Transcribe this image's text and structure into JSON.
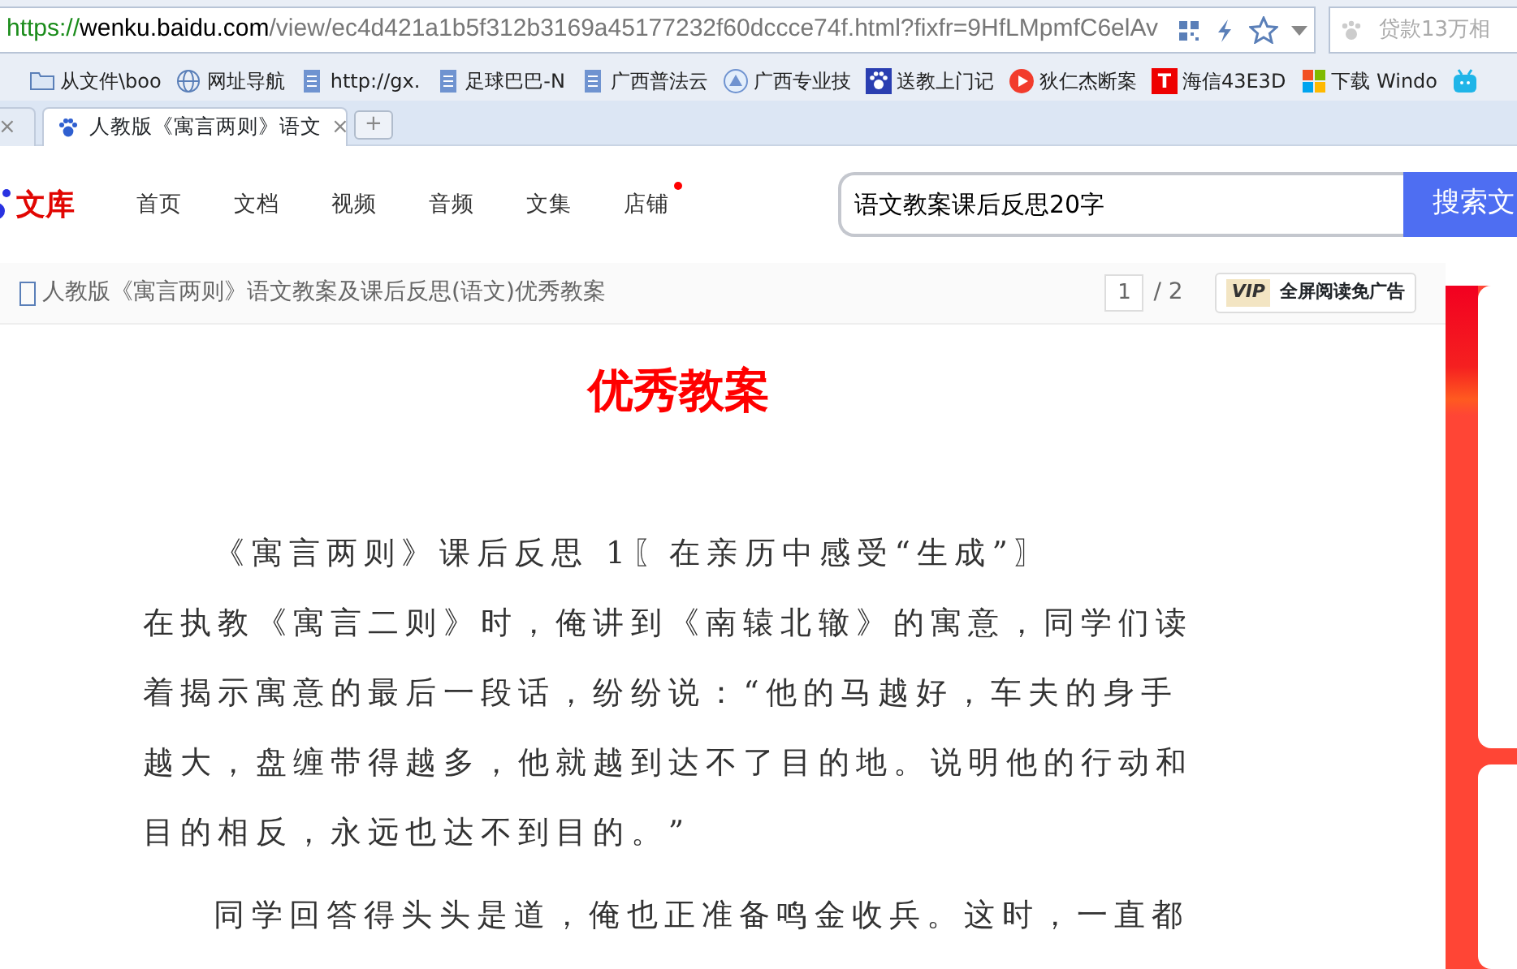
{
  "address_bar": {
    "scheme": "https://",
    "host": "wenku.baidu.com",
    "path": "/view/ec4d421a1b5f312b3169a45177232f60dccce74f.html?fixfr=9HfLMpmfC6elAv",
    "search_placeholder": "贷款13万相"
  },
  "bookmarks": [
    {
      "label": "从文件\\boo",
      "kind": "folder"
    },
    {
      "label": "网址导航",
      "kind": "globe"
    },
    {
      "label": "http://gx.",
      "kind": "page"
    },
    {
      "label": "足球巴巴-N",
      "kind": "page"
    },
    {
      "label": "广西普法云",
      "kind": "page"
    },
    {
      "label": "广西专业技",
      "kind": "cloud"
    },
    {
      "label": "送教上门记",
      "kind": "paw"
    },
    {
      "label": "狄仁杰断案",
      "kind": "play"
    },
    {
      "label": "海信43E3D",
      "kind": "letter",
      "mark": "T"
    },
    {
      "label": "下载 Windo",
      "kind": "windows"
    },
    {
      "kind": "tv"
    }
  ],
  "tabs": [
    {
      "close": "×",
      "selected": false
    },
    {
      "title": "人教版《寓言两则》语文",
      "close": "×",
      "selected": true
    }
  ],
  "new_tab": "+",
  "site": {
    "logo": "文库",
    "nav": [
      {
        "label": "首页",
        "dot": false
      },
      {
        "label": "文档",
        "dot": false
      },
      {
        "label": "视频",
        "dot": false
      },
      {
        "label": "音频",
        "dot": false
      },
      {
        "label": "文集",
        "dot": false
      },
      {
        "label": "店铺",
        "dot": true
      }
    ],
    "search_value": "语文教案课后反思20字",
    "search_button": "搜索文"
  },
  "doc_bar": {
    "title": "人教版《寓言两则》语文教案及课后反思(语文)优秀教案",
    "page": "1",
    "pages": "/ 2",
    "vip": "VIP",
    "vip_text": "全屏阅读免广告"
  },
  "document": {
    "title_line": "优秀教案",
    "paragraphs": [
      {
        "kind": "indent",
        "text": "《寓言两则》课后反思 1〖在亲历中感受“生成”〗"
      },
      {
        "kind": "plain",
        "text": "在执教《寓言二则》时，俺讲到《南辕北辙》的寓意，同学们读着揭示寓意的最后一段话，纷纷说：“他的马越好，车夫的身手越大，盘缠带得越多，他就越到达不了目的地。说明他的行动和目的相反，永远也达不到目的。”"
      },
      {
        "kind": "indent",
        "text": "同学回答得头头是道，俺也正准备鸣金收兵。这时，一直都"
      }
    ]
  }
}
